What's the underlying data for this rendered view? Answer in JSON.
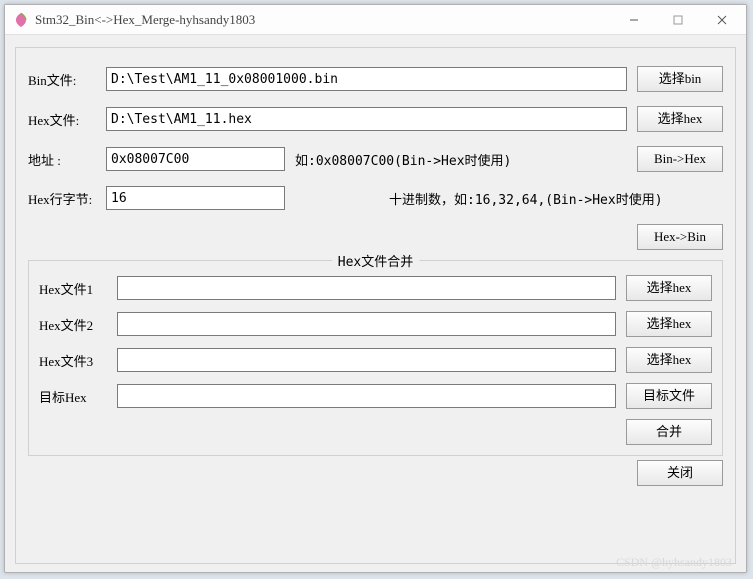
{
  "window": {
    "title": "Stm32_Bin<->Hex_Merge-hyhsandy1803"
  },
  "labels": {
    "bin_file": "Bin文件:",
    "hex_file": "Hex文件:",
    "address": "地址   :",
    "row_bytes": "Hex行字节:",
    "hex_file1": "Hex文件1",
    "hex_file2": "Hex文件2",
    "hex_file3": "Hex文件3",
    "target_hex": "目标Hex",
    "group_title": "Hex文件合并"
  },
  "values": {
    "bin_path": "D:\\Test\\AM1_11_0x08001000.bin",
    "hex_path": "D:\\Test\\AM1_11.hex",
    "address": "0x08007C00",
    "row_bytes": "16",
    "hex1": "",
    "hex2": "",
    "hex3": "",
    "target": ""
  },
  "hints": {
    "address": "如:0x08007C00(Bin->Hex时使用)",
    "row_bytes": "十进制数，如:16,32,64,(Bin->Hex时使用)"
  },
  "buttons": {
    "select_bin": "选择bin",
    "select_hex": "选择hex",
    "bin_to_hex": "Bin->Hex",
    "hex_to_bin": "Hex->Bin",
    "select_hex1": "选择hex",
    "select_hex2": "选择hex",
    "select_hex3": "选择hex",
    "target_file": "目标文件",
    "merge": "合并",
    "close": "关闭"
  },
  "watermark": "CSDN @hyhsandy1803"
}
